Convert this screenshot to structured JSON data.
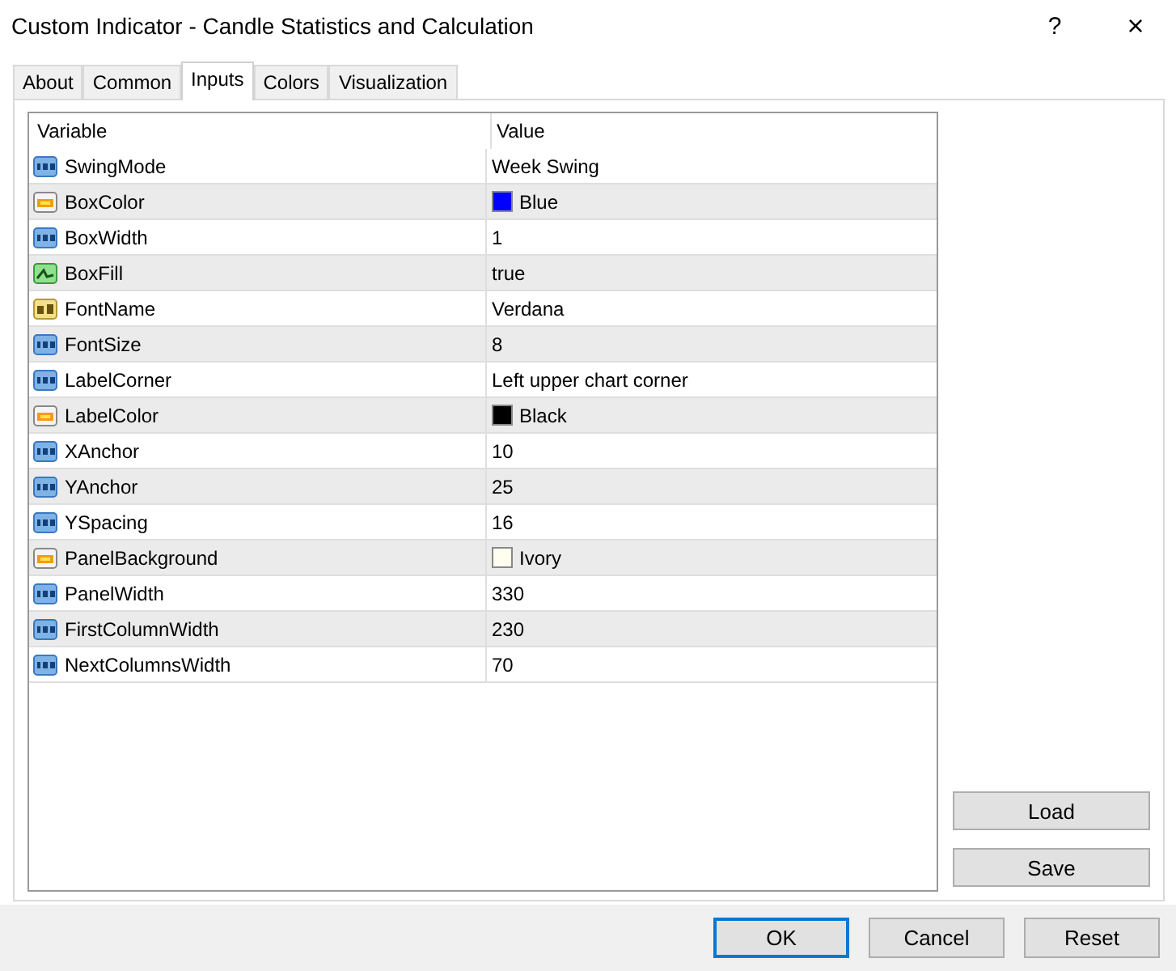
{
  "window": {
    "title": "Custom Indicator - Candle Statistics and Calculation",
    "help": "?",
    "close": "×"
  },
  "tabs": [
    {
      "label": "About",
      "selected": false
    },
    {
      "label": "Common",
      "selected": false
    },
    {
      "label": "Inputs",
      "selected": true
    },
    {
      "label": "Colors",
      "selected": false
    },
    {
      "label": "Visualization",
      "selected": false
    }
  ],
  "table": {
    "columns": [
      "Variable",
      "Value"
    ],
    "rows": [
      {
        "kind": "number",
        "variable": "SwingMode",
        "value": "Week Swing"
      },
      {
        "kind": "color",
        "variable": "BoxColor",
        "value": "Blue",
        "color": "#0000ff"
      },
      {
        "kind": "number",
        "variable": "BoxWidth",
        "value": "1"
      },
      {
        "kind": "bool",
        "variable": "BoxFill",
        "value": "true"
      },
      {
        "kind": "string",
        "variable": "FontName",
        "value": "Verdana"
      },
      {
        "kind": "number",
        "variable": "FontSize",
        "value": "8"
      },
      {
        "kind": "number",
        "variable": "LabelCorner",
        "value": "Left upper chart corner"
      },
      {
        "kind": "color",
        "variable": "LabelColor",
        "value": "Black",
        "color": "#000000"
      },
      {
        "kind": "number",
        "variable": "XAnchor",
        "value": "10"
      },
      {
        "kind": "number",
        "variable": "YAnchor",
        "value": "25"
      },
      {
        "kind": "number",
        "variable": "YSpacing",
        "value": "16"
      },
      {
        "kind": "color",
        "variable": "PanelBackground",
        "value": "Ivory",
        "color": "#fffff0"
      },
      {
        "kind": "number",
        "variable": "PanelWidth",
        "value": "330"
      },
      {
        "kind": "number",
        "variable": "FirstColumnWidth",
        "value": "230"
      },
      {
        "kind": "number",
        "variable": "NextColumnsWidth",
        "value": "70"
      }
    ]
  },
  "side_buttons": [
    "Load",
    "Save"
  ],
  "buttons": [
    "OK",
    "Cancel",
    "Reset"
  ]
}
